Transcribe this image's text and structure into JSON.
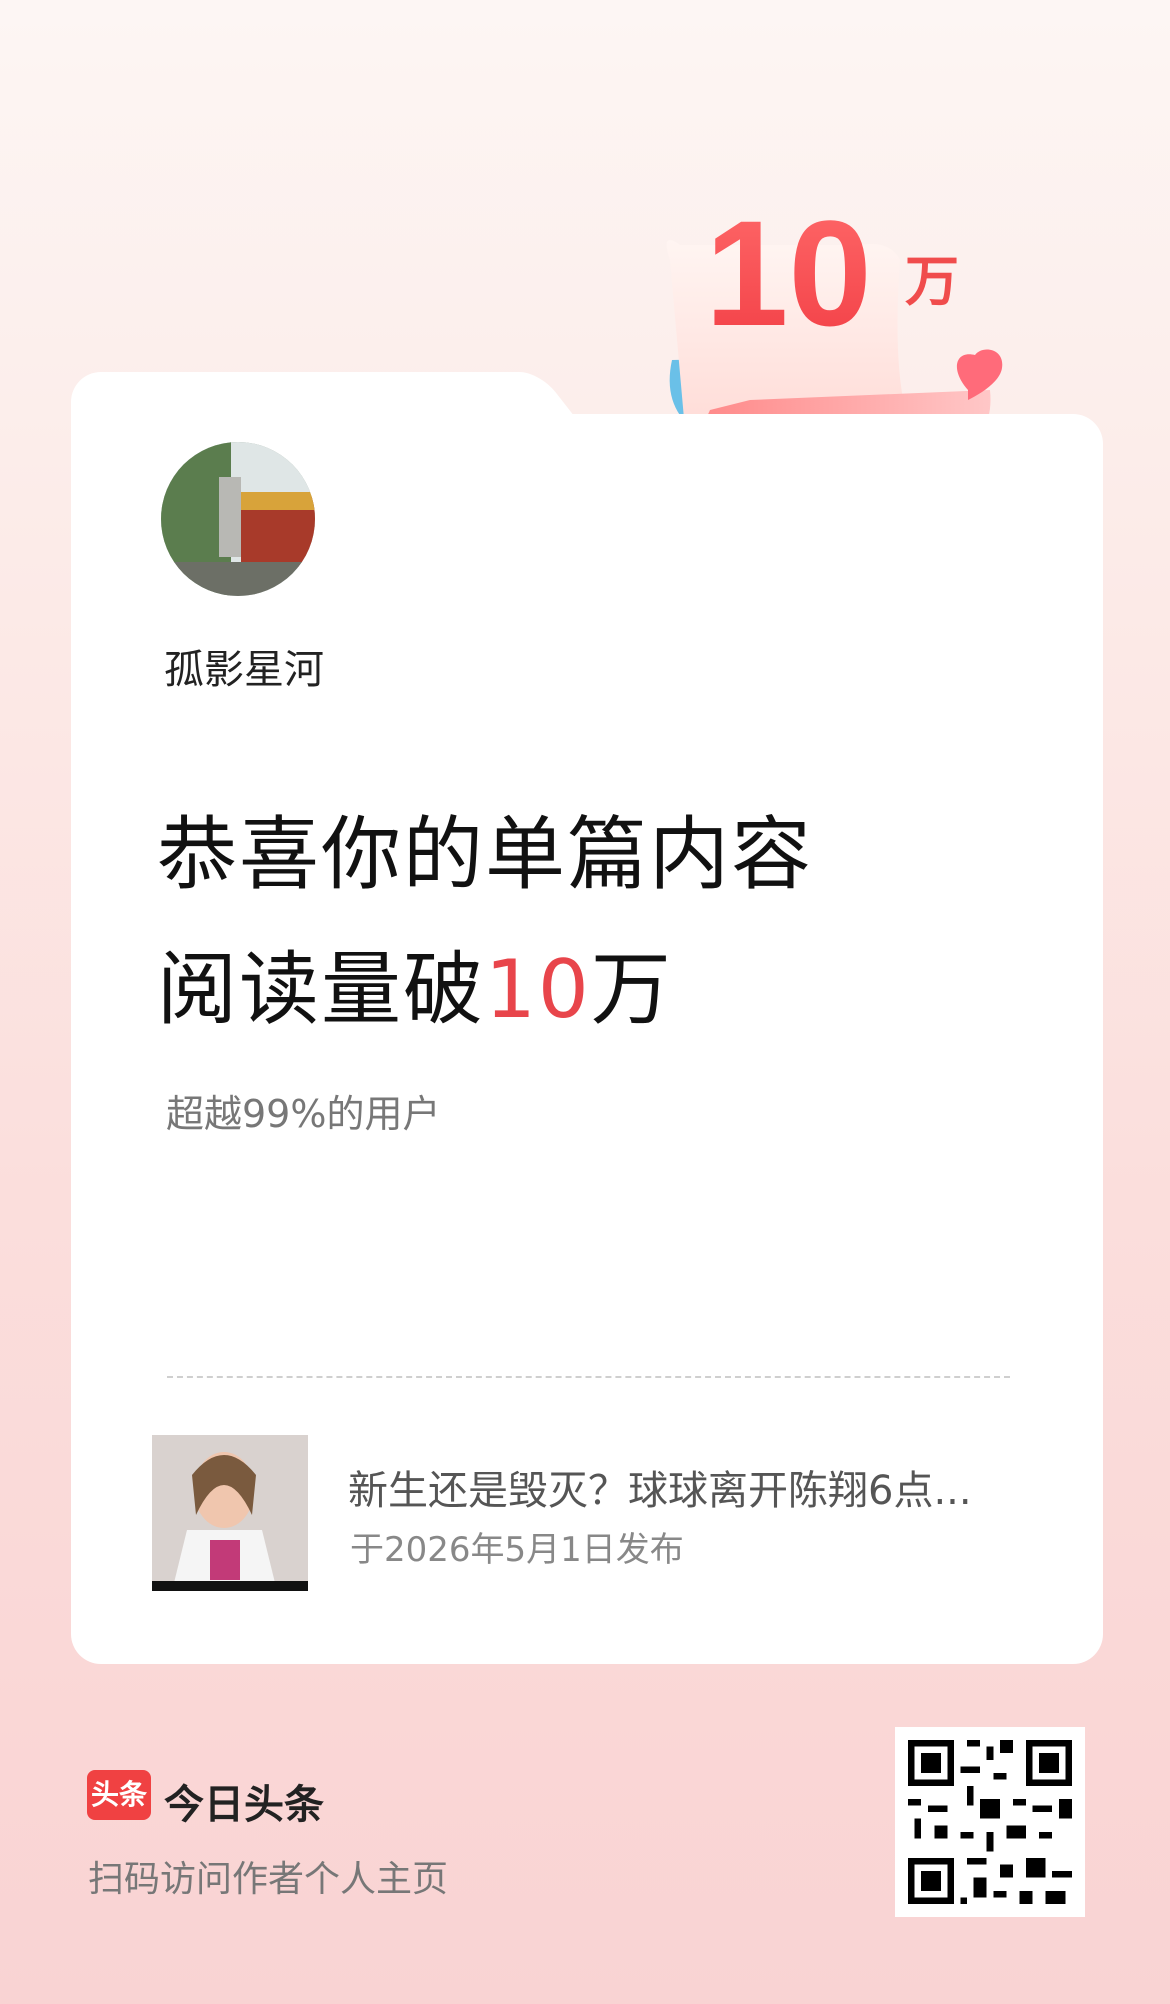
{
  "badge": {
    "number": "10",
    "unit": "万"
  },
  "user": {
    "name": "孤影星河"
  },
  "headline": {
    "line1": "恭喜你的单篇内容",
    "line2_prefix": "阅读量破",
    "line2_number": "10",
    "line2_suffix": "万"
  },
  "subtitle": "超越99%的用户",
  "article": {
    "title": "新生还是毁灭？球球离开陈翔6点...",
    "date": "于2026年5月1日发布"
  },
  "footer": {
    "logo_text": "头条",
    "brand": "今日头条",
    "scan_text": "扫码访问作者个人主页"
  },
  "colors": {
    "accent": "#e8454b",
    "brand": "#f04142"
  }
}
